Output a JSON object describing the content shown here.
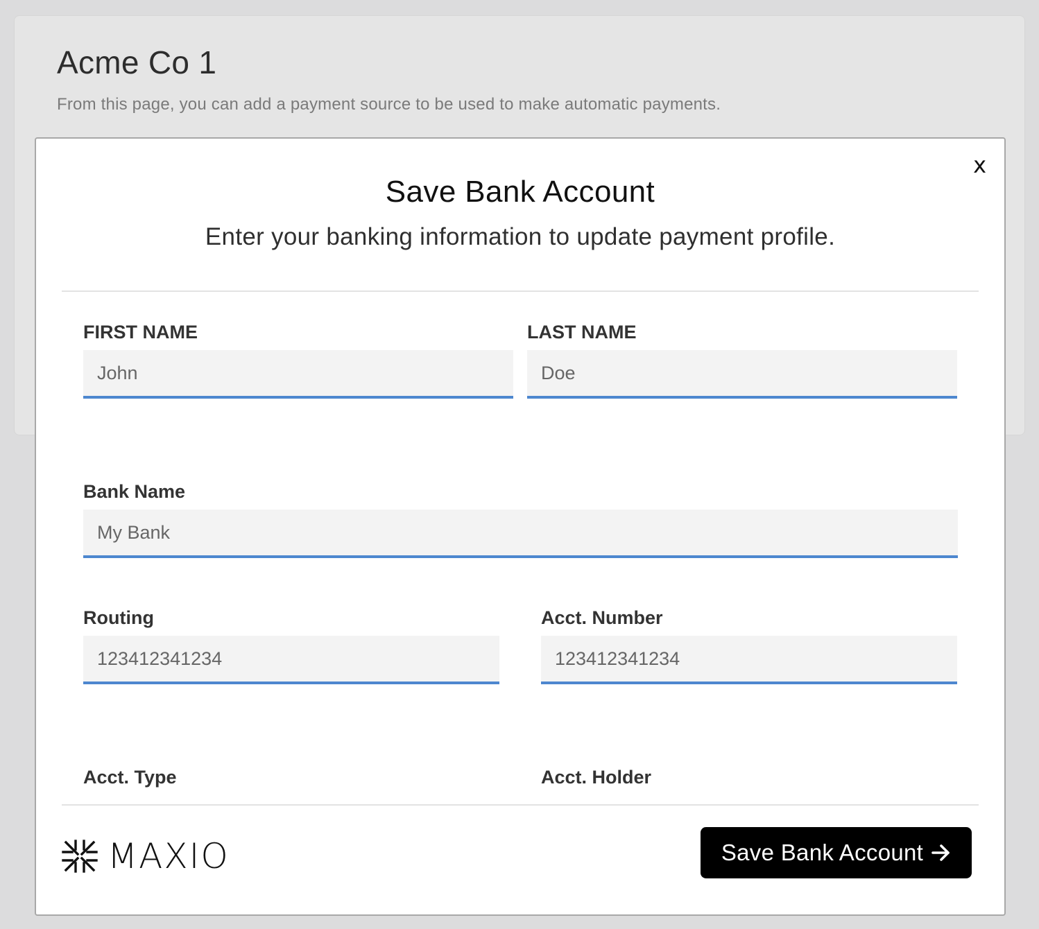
{
  "page": {
    "title": "Acme Co 1",
    "description": "From this page, you can add a payment source to be used to make automatic payments."
  },
  "modal": {
    "close_label": "x",
    "title": "Save Bank Account",
    "subtitle": "Enter your banking information to update payment profile."
  },
  "form": {
    "first_name": {
      "label": "FIRST NAME",
      "placeholder": "John"
    },
    "last_name": {
      "label": "LAST NAME",
      "placeholder": "Doe"
    },
    "bank_name": {
      "label": "Bank Name",
      "placeholder": "My Bank"
    },
    "routing": {
      "label": "Routing",
      "placeholder": "123412341234"
    },
    "account_number": {
      "label": "Acct. Number",
      "placeholder": "123412341234"
    },
    "account_type": {
      "label": "Acct. Type"
    },
    "account_holder": {
      "label": "Acct. Holder"
    }
  },
  "footer": {
    "logo_text": "MAXIO",
    "logo_icon": "maxio-logo-icon",
    "save_label": "Save Bank Account",
    "save_icon": "arrow-right-icon"
  },
  "colors": {
    "accent": "#4d87cf",
    "button_bg": "#000000",
    "page_bg": "#dcdcdd"
  }
}
